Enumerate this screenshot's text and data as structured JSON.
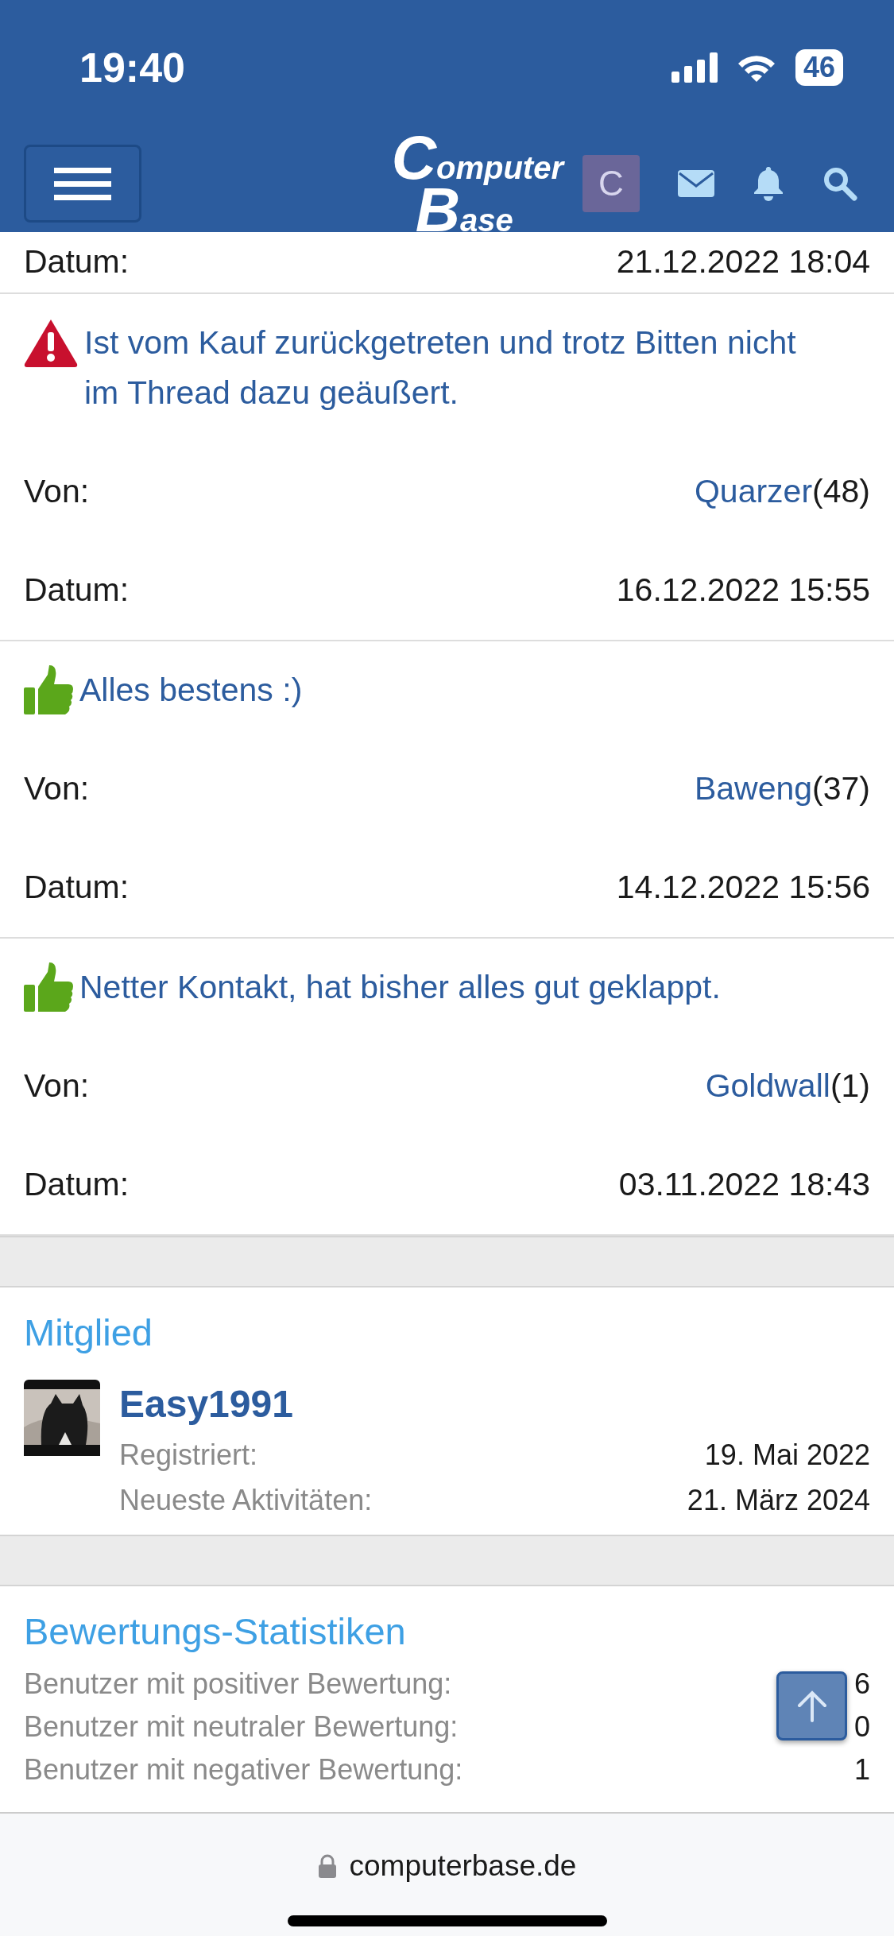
{
  "status_bar": {
    "time": "19:40",
    "battery": "46"
  },
  "navbar": {
    "logo": [
      "Computer",
      "Base"
    ],
    "avatar_letter": "C"
  },
  "top_row": {
    "label": "Datum:",
    "value": "21.12.2022 18:04"
  },
  "feedback": [
    {
      "kind": "negative",
      "message": "Ist vom Kauf zurückgetreten und trotz Bitten nicht im Thread dazu geäußert.",
      "from_label": "Von:",
      "from_user": "Quarzer",
      "from_count": "(48)",
      "date_label": "Datum:",
      "date": "16.12.2022 15:55"
    },
    {
      "kind": "positive",
      "message": "Alles bestens :)",
      "from_label": "Von:",
      "from_user": "Baweng",
      "from_count": "(37)",
      "date_label": "Datum:",
      "date": "14.12.2022 15:56"
    },
    {
      "kind": "positive",
      "message": "Netter Kontakt, hat bisher alles gut geklappt.",
      "from_label": "Von:",
      "from_user": "Goldwall",
      "from_count": "(1)",
      "date_label": "Datum:",
      "date": "03.11.2022 18:43"
    }
  ],
  "member": {
    "heading": "Mitglied",
    "name": "Easy1991",
    "rows": [
      {
        "label": "Registriert:",
        "value": "19. Mai 2022"
      },
      {
        "label": "Neueste Aktivitäten:",
        "value": "21. März 2024"
      }
    ]
  },
  "stats": {
    "heading": "Bewertungs-Statistiken",
    "rows": [
      {
        "label": "Benutzer mit positiver Bewertung:",
        "value": "6"
      },
      {
        "label": "Benutzer mit neutraler Bewertung:",
        "value": "0"
      },
      {
        "label": "Benutzer mit negativer Bewertung:",
        "value": "1"
      }
    ]
  },
  "browser": {
    "url": "computerbase.de"
  }
}
